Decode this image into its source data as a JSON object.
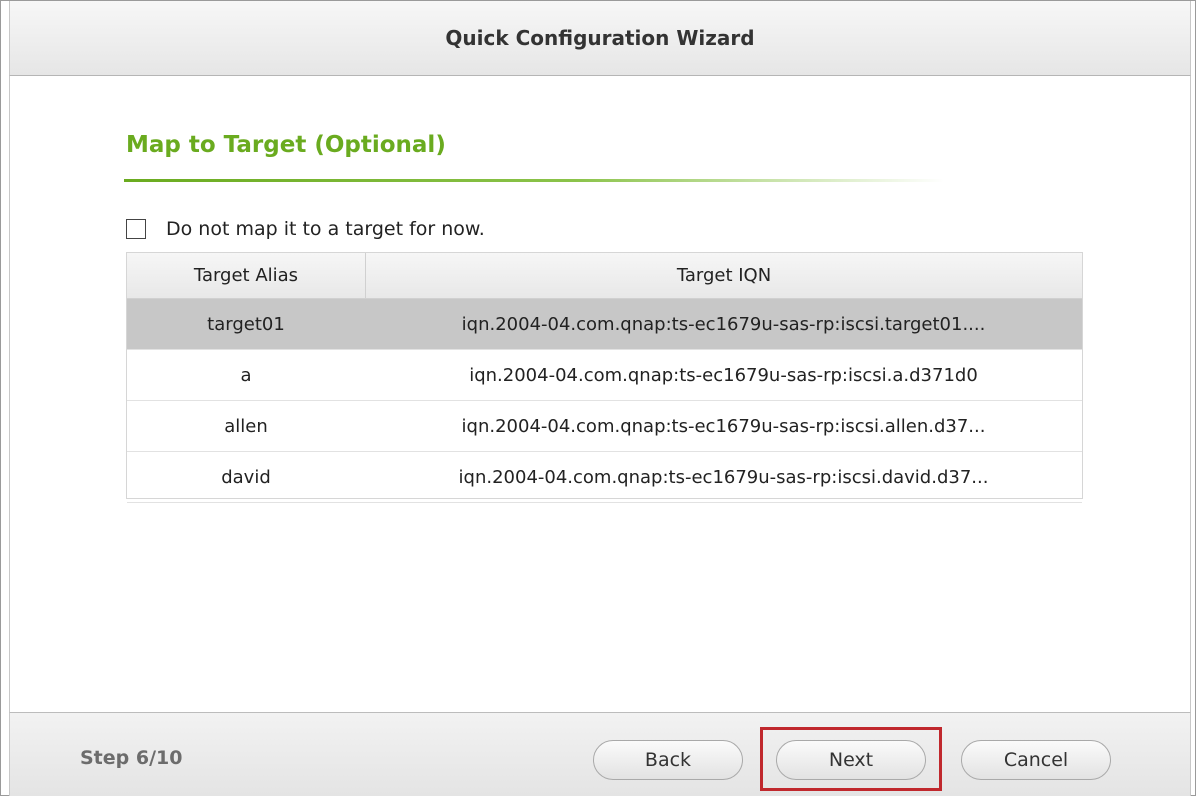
{
  "window": {
    "title": "Quick Configuration Wizard"
  },
  "section": {
    "title": "Map to Target (Optional)"
  },
  "options": {
    "skip_mapping_label": "Do not map it to a target for now.",
    "skip_mapping_checked": false
  },
  "table": {
    "headers": [
      "Target Alias",
      "Target IQN"
    ],
    "rows": [
      {
        "alias": "target01",
        "iqn": "iqn.2004-04.com.qnap:ts-ec1679u-sas-rp:iscsi.target01....",
        "selected": true
      },
      {
        "alias": "a",
        "iqn": "iqn.2004-04.com.qnap:ts-ec1679u-sas-rp:iscsi.a.d371d0",
        "selected": false
      },
      {
        "alias": "allen",
        "iqn": "iqn.2004-04.com.qnap:ts-ec1679u-sas-rp:iscsi.allen.d37...",
        "selected": false
      },
      {
        "alias": "david",
        "iqn": "iqn.2004-04.com.qnap:ts-ec1679u-sas-rp:iscsi.david.d37...",
        "selected": false
      }
    ]
  },
  "footer": {
    "step": "Step 6/10",
    "back_label": "Back",
    "next_label": "Next",
    "cancel_label": "Cancel"
  },
  "colors": {
    "section_title": "#6aab1f",
    "highlight": "#c0282d",
    "selected_row": "#c7c7c7"
  }
}
